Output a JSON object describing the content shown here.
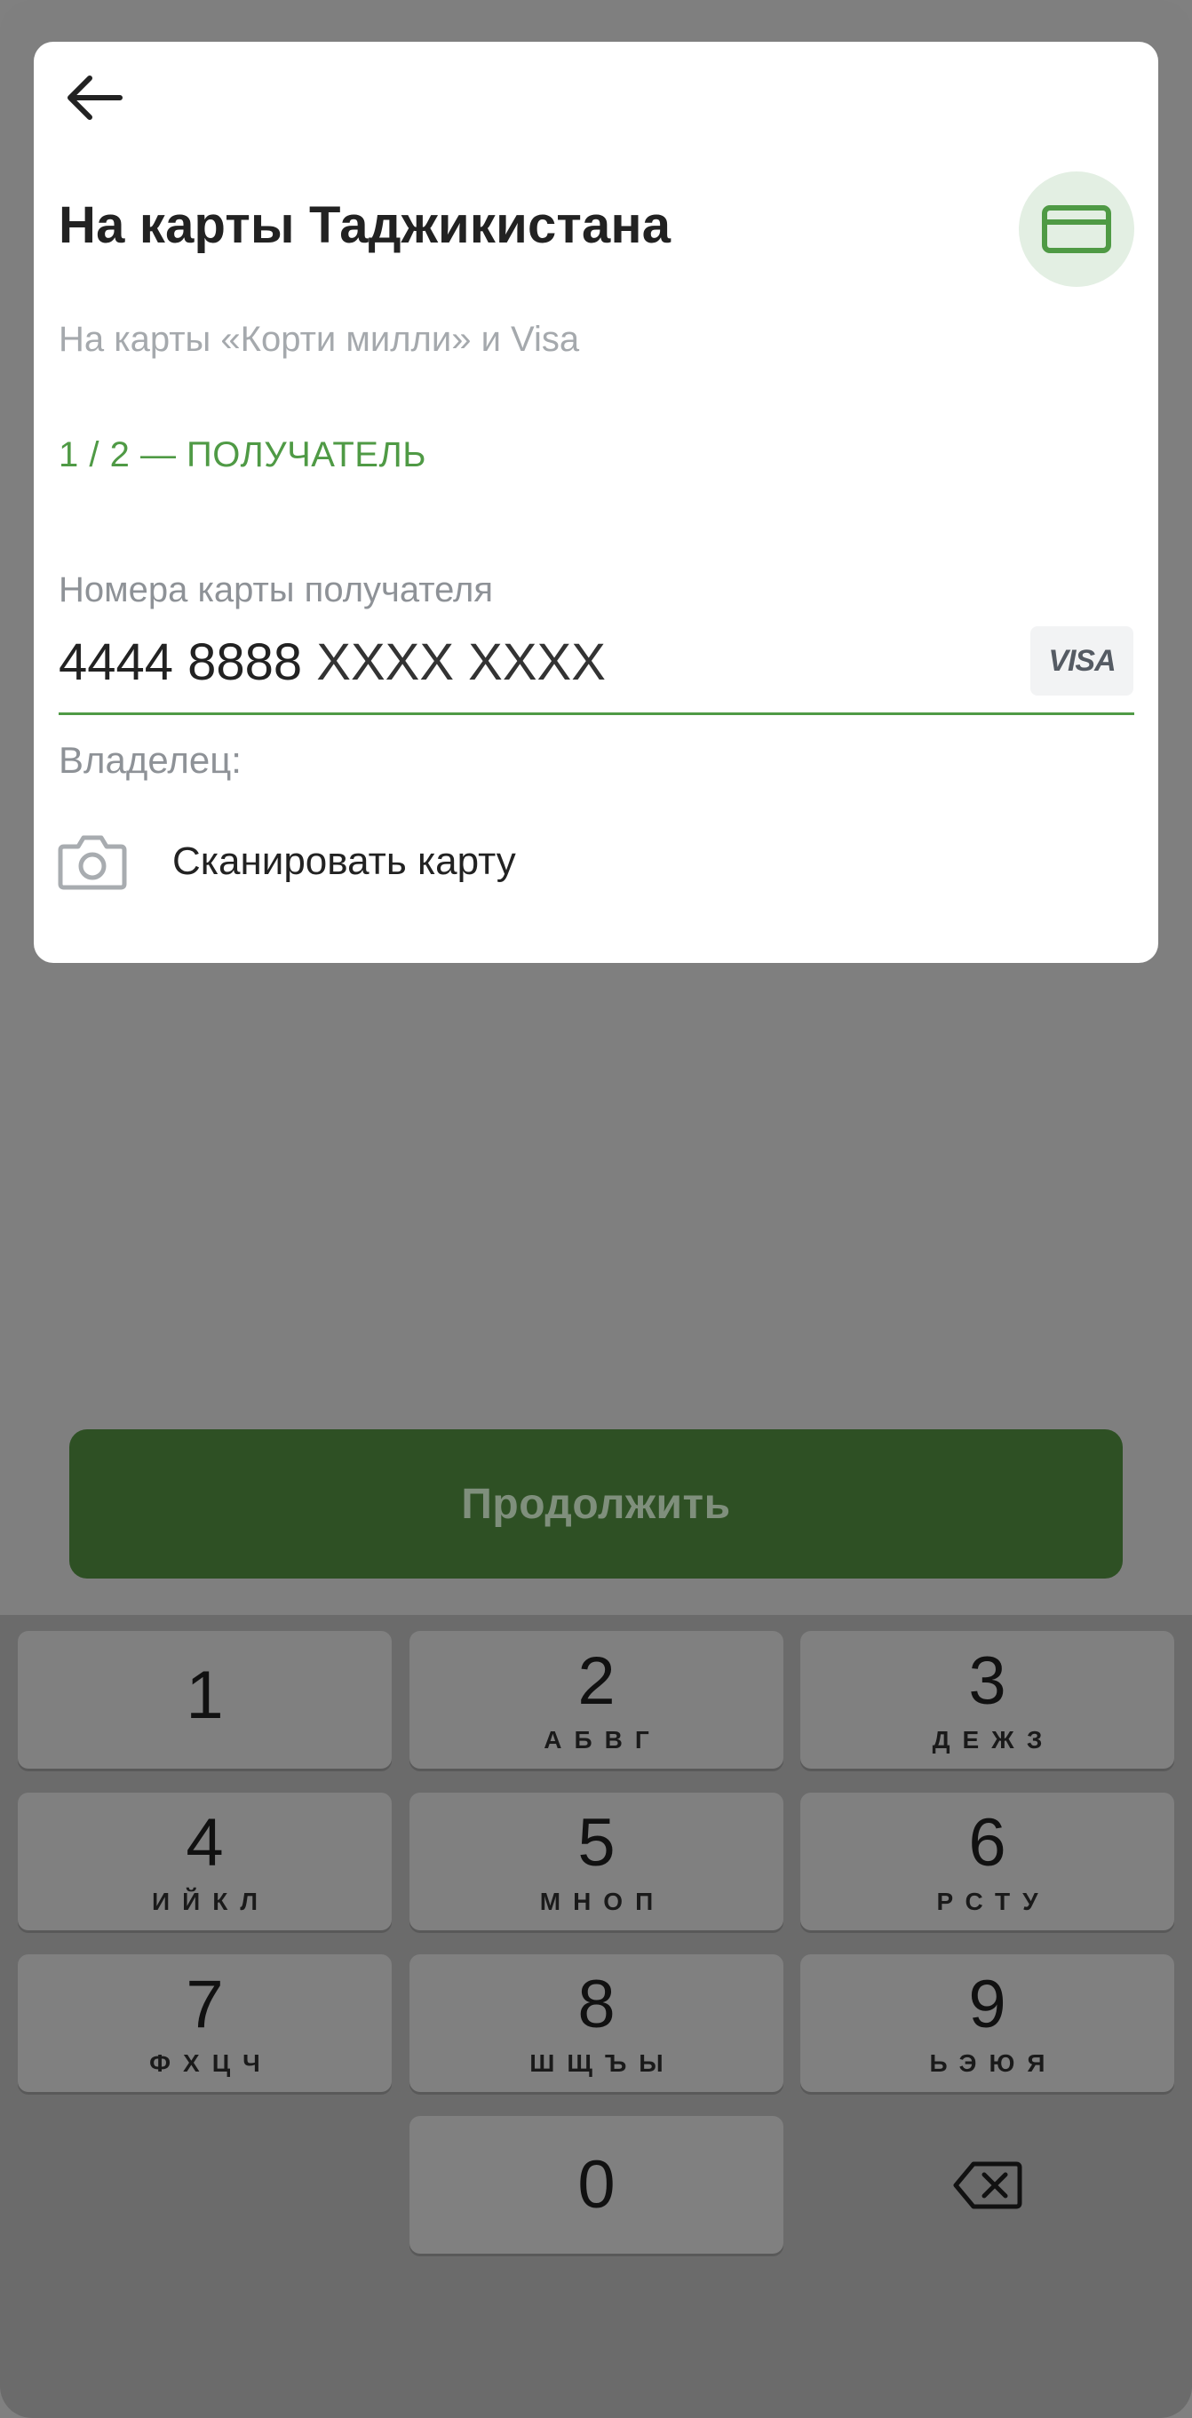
{
  "header": {
    "title": "На карты Таджикистана",
    "subtitle": "На карты «Корти милли» и Visa",
    "step": "1 / 2 — ПОЛУЧАТЕЛЬ"
  },
  "card_field": {
    "label": "Номера карты получателя",
    "value_digits": "4444 8888",
    "value_mask": "XXXX XXXX",
    "brand": "VISA",
    "owner_label": "Владелец:"
  },
  "scan": {
    "label": "Сканировать карту",
    "icon": "camera-icon"
  },
  "continue_button": {
    "label": "Продолжить",
    "enabled": false
  },
  "keypad": {
    "keys": [
      {
        "digit": "1",
        "letters": ""
      },
      {
        "digit": "2",
        "letters": "АБВГ"
      },
      {
        "digit": "3",
        "letters": "ДЕЖЗ"
      },
      {
        "digit": "4",
        "letters": "ИЙКЛ"
      },
      {
        "digit": "5",
        "letters": "МНОП"
      },
      {
        "digit": "6",
        "letters": "РСТУ"
      },
      {
        "digit": "7",
        "letters": "ФХЦЧ"
      },
      {
        "digit": "8",
        "letters": "ШЩЪЫ"
      },
      {
        "digit": "9",
        "letters": "ЬЭЮЯ"
      },
      {
        "digit": "0",
        "letters": ""
      }
    ],
    "delete_icon": "backspace-icon"
  },
  "colors": {
    "accent_green": "#4f9a45",
    "button_green": "#2e5024",
    "overlay_gray": "#7f7f7f",
    "keypad_bg": "#6b6b6b"
  }
}
